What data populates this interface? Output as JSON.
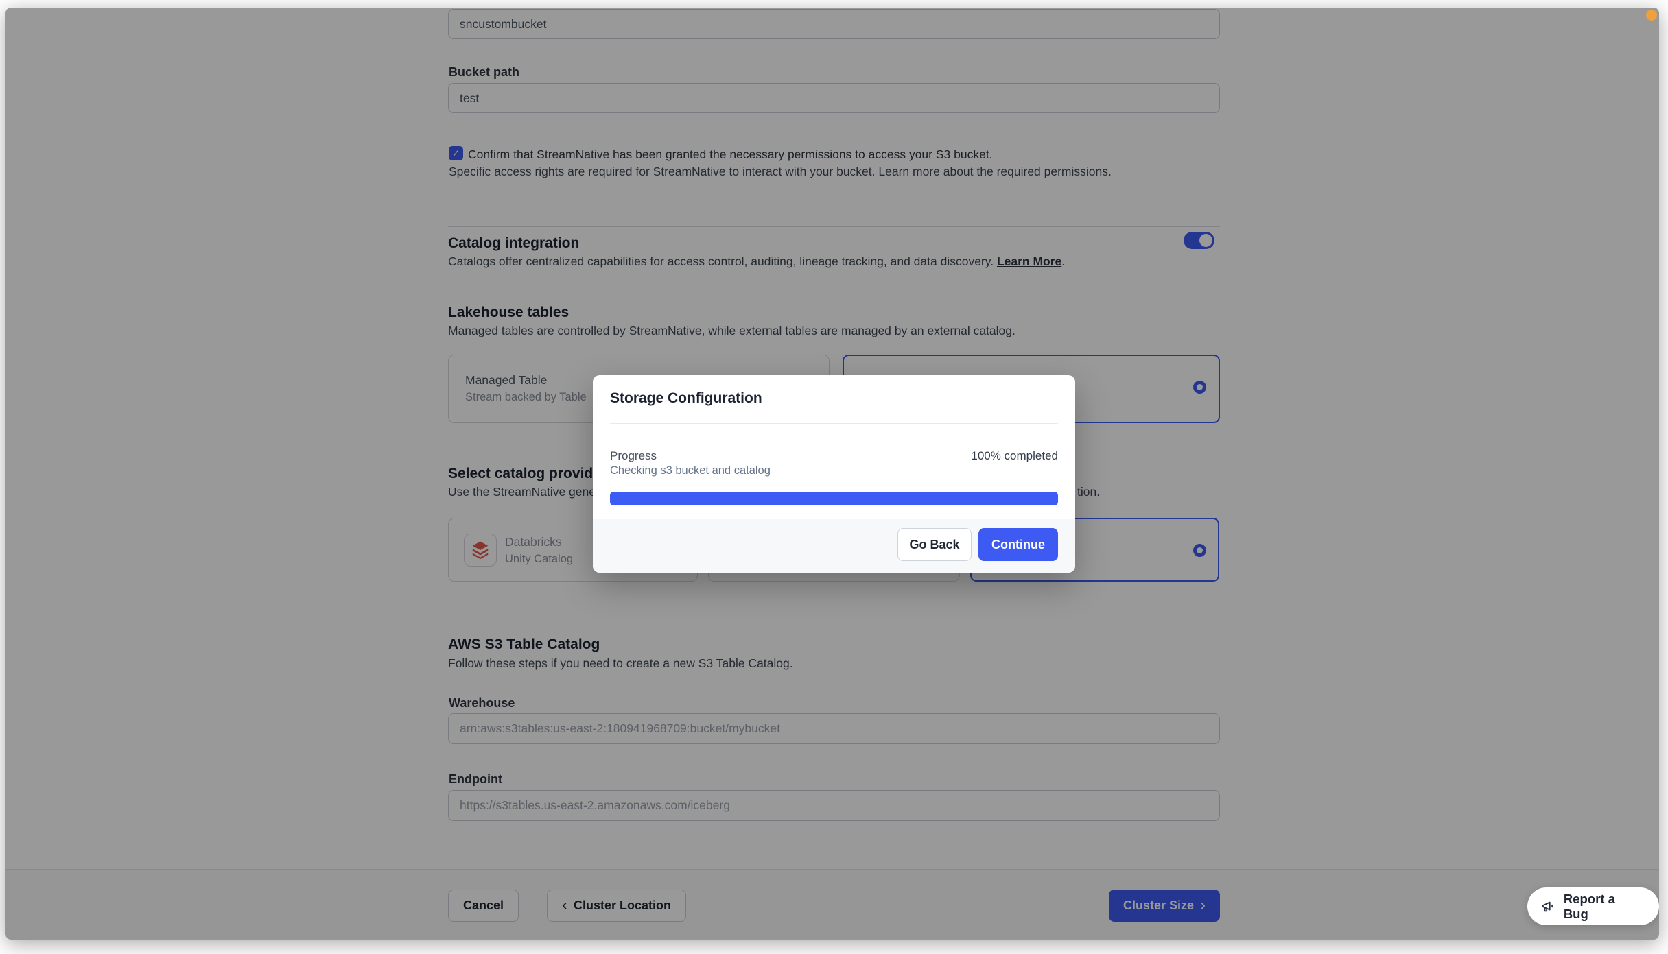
{
  "page": {
    "bucket_name_value": "sncustombucket",
    "bucket_path_label": "Bucket path",
    "bucket_path_value": "test",
    "confirm_line1": "Confirm that StreamNative has been granted the necessary permissions to access your S3 bucket.",
    "confirm_line2": "Specific access rights are required for StreamNative to interact with your bucket. Learn more about the required permissions.",
    "catalog_integration": {
      "title": "Catalog integration",
      "description": "Catalogs offer centralized capabilities for access control, auditing, lineage tracking, and data discovery. ",
      "learn_more": "Learn More",
      "period": "."
    },
    "lakehouse": {
      "title": "Lakehouse tables",
      "description": "Managed tables are controlled by StreamNative, while external tables are managed by an external catalog.",
      "managed_card": {
        "title": "Managed Table",
        "subtitle": "Stream backed by Table"
      }
    },
    "provider": {
      "heading_visible": "Select catalog provide",
      "desc_left_visible": "Use the StreamNative gene",
      "desc_right_visible": "tion.",
      "databricks_card": {
        "line1": "Databricks",
        "line2": "Unity Catalog"
      }
    },
    "aws": {
      "title": "AWS S3 Table Catalog",
      "description": "Follow these steps if you need to create a new S3 Table Catalog.",
      "warehouse_label": "Warehouse",
      "warehouse_placeholder": "arn:aws:s3tables:us-east-2:180941968709:bucket/mybucket",
      "endpoint_label": "Endpoint",
      "endpoint_placeholder": "https://s3tables.us-east-2.amazonaws.com/iceberg"
    },
    "footer": {
      "cancel": "Cancel",
      "back": "Cluster Location",
      "next": "Cluster Size"
    },
    "report_bug": "Report a Bug"
  },
  "modal": {
    "title": "Storage Configuration",
    "progress_label": "Progress",
    "progress_status": "100% completed",
    "progress_detail": "Checking s3 bucket and catalog",
    "progress_percent": 100,
    "go_back": "Go Back",
    "continue_label": "Continue"
  },
  "icons": {
    "check": "✓",
    "chevron_left": "‹",
    "chevron_right": "›"
  },
  "colors": {
    "accent": "#3D5BF0",
    "progress_fill": "#3D5BF5",
    "overlay": "rgba(0,0,0,0.4)",
    "notification_dot": "#F0A03C"
  }
}
